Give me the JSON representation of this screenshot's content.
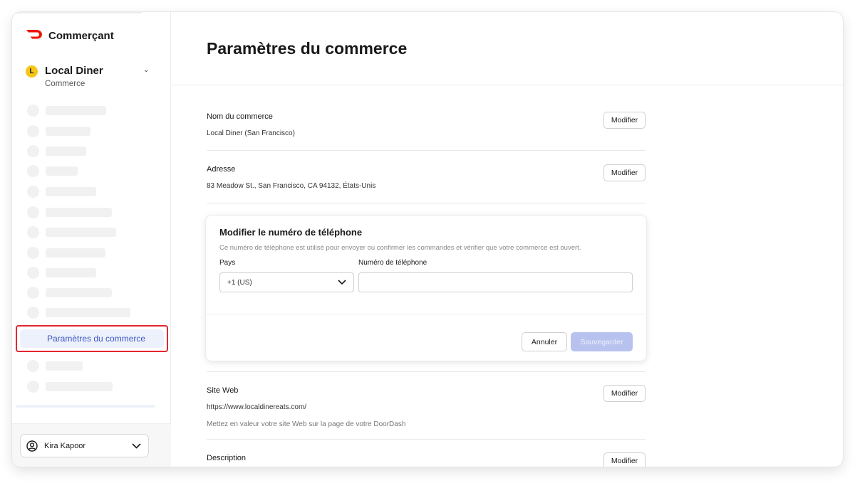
{
  "app": {
    "brand_name": "Commerçant",
    "brand_color": "#eb1700"
  },
  "store": {
    "initial": "L",
    "name": "Local Diner",
    "type": "Commerce"
  },
  "sidebar": {
    "active_item_label": "Paramètres du commerce",
    "active_color": "#3a55c5",
    "highlight_color": "#e3262f"
  },
  "user": {
    "name": "Kira Kapoor"
  },
  "page": {
    "title": "Paramètres du commerce"
  },
  "fields": {
    "store_name": {
      "label": "Nom du commerce",
      "value": "Local Diner (San Francisco)",
      "button": "Modifier"
    },
    "address": {
      "label": "Adresse",
      "value": "83 Meadow St., San Francisco, CA 94132, États-Unis",
      "button": "Modifier"
    },
    "website": {
      "label": "Site Web",
      "value": "https://www.localdinereats.com/",
      "hint": "Mettez en valeur votre site Web sur la page de votre DoorDash",
      "button": "Modifier"
    },
    "description": {
      "label": "Description",
      "button": "Modifier"
    }
  },
  "phone_dialog": {
    "title": "Modifier le numéro de téléphone",
    "description": "Ce numéro de téléphone est utilisé pour envoyer ou confirmer les commandes et vérifier que votre commerce est ouvert.",
    "country_label": "Pays",
    "country_value": "+1 (US)",
    "phone_label": "Numéro de téléphone",
    "phone_value": "",
    "cancel_label": "Annuler",
    "save_label": "Sauvegarder"
  }
}
